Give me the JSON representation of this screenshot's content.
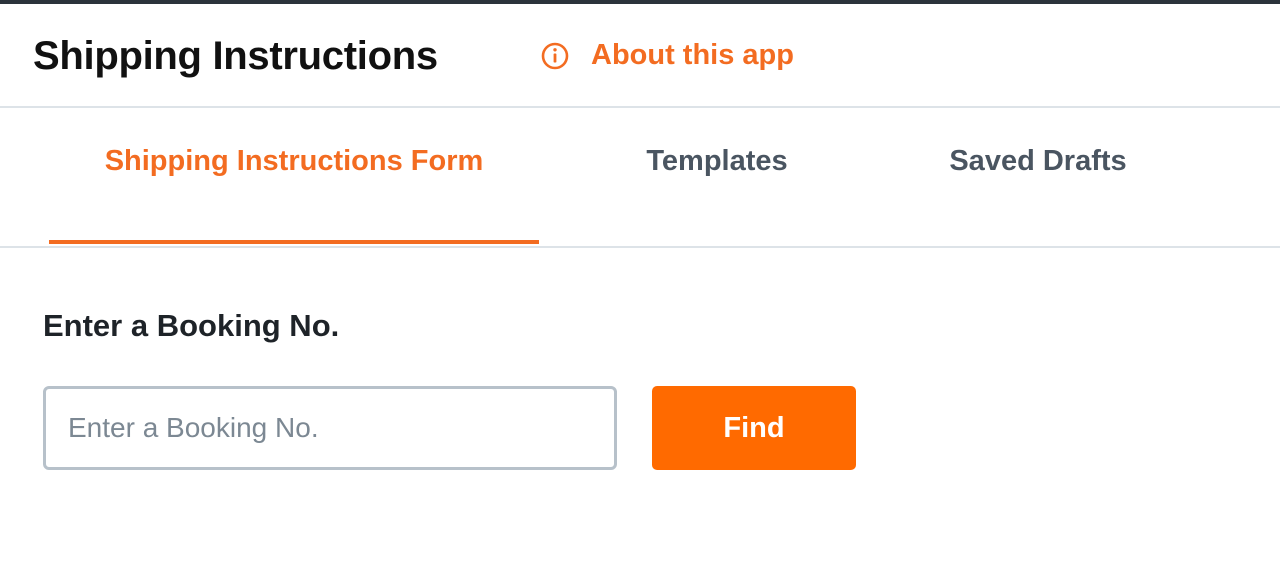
{
  "header": {
    "title": "Shipping Instructions",
    "about_link": {
      "label": "About this app",
      "icon": "info-circle-icon"
    }
  },
  "tabs": [
    {
      "label": "Shipping Instructions Form",
      "active": true
    },
    {
      "label": "Templates",
      "active": false
    },
    {
      "label": "Saved Drafts",
      "active": false
    }
  ],
  "booking_form": {
    "title": "Enter a Booking No.",
    "input": {
      "value": "",
      "placeholder": "Enter a Booking No."
    },
    "find_label": "Find"
  },
  "colors": {
    "accent": "#f36c21",
    "button": "#ff6a00",
    "top_strip": "#2b333b",
    "tab_inactive": "#4a5561",
    "divider": "#dde3e8"
  }
}
